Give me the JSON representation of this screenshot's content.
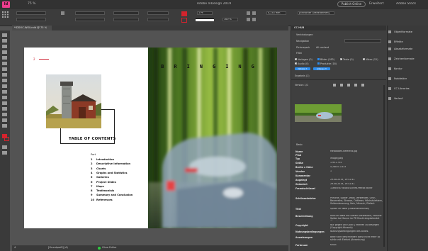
{
  "titlebar": {
    "app_badge": "Id",
    "zoom": "75 %",
    "title": "Adobe InDesign 2019",
    "workspace": "[Einfacher Grafikrahmen]",
    "publish_label": "Publish Online",
    "extended_label": "Erweitert",
    "search_placeholder": "Adobe Stock"
  },
  "control_bar": {
    "stroke_weight": "1 Pt",
    "opacity": "100 %",
    "width_value": "4,233 mm"
  },
  "document": {
    "tab_label": "*IDDOC-WOLindd @ 75 %",
    "page_number": "2",
    "toc_title": "TABLE OF CONTENTS",
    "part_label": "Part",
    "toc_items": [
      {
        "num": "1",
        "name": "Introduction"
      },
      {
        "num": "2",
        "name": "Descriptive Information"
      },
      {
        "num": "3",
        "name": "Charts"
      },
      {
        "num": "4",
        "name": "Graphs and Statistics"
      },
      {
        "num": "5",
        "name": "Galleries"
      },
      {
        "num": "6",
        "name": "Project Slides"
      },
      {
        "num": "7",
        "name": "Maps"
      },
      {
        "num": "8",
        "name": "Testimonials"
      },
      {
        "num": "9",
        "name": "Summary and Conclusion"
      },
      {
        "num": "10",
        "name": "References"
      }
    ],
    "spread_headline": "BRINGING"
  },
  "status_bar": {
    "page": "4",
    "profile": "[Grundprofil] (A)",
    "errors": "Ohne Fehler"
  },
  "cc_hub": {
    "title": "CC HUB",
    "connections": "Verbindungen",
    "navigation": "Navigation",
    "picture_mode": "Picturepark",
    "all_content": "All content",
    "filter": "Filter",
    "checkboxes_row1": [
      {
        "label": "Vorlagen (0)",
        "checked": false
      },
      {
        "label": "Bilder (183)",
        "checked": true
      },
      {
        "label": "Texte (0)",
        "checked": false
      },
      {
        "label": "Video (12)",
        "checked": false
      }
    ],
    "checkboxes_row2": [
      {
        "label": "Audio (0)",
        "checked": false
      },
      {
        "label": "Produkte (18)",
        "checked": true
      }
    ],
    "filter_tags": [
      "Natalie ✕",
      "Adresse ✕"
    ],
    "results_label": "Ergebnis (1)",
    "version_label": "Version 1/1",
    "section_basic": "Basic",
    "metadata": [
      {
        "key": "Name",
        "value": "Metadaten-Referenz.jpg"
      },
      {
        "key": "Pfad",
        "value": ""
      },
      {
        "key": "Typ",
        "value": "image/jpeg"
      },
      {
        "key": "Größe",
        "value": "1.951.754"
      },
      {
        "key": "Breite x Höhe",
        "value": "4.288 x 1.833"
      },
      {
        "key": "Version",
        "value": "1"
      },
      {
        "key": "Kommentar",
        "value": ""
      },
      {
        "key": "Angelegt",
        "value": "29.08.2019, 19:52:41"
      },
      {
        "key": "Geändert",
        "value": "29.08.2019, 19:52:41"
      },
      {
        "key": "Fremdschlüssel",
        "value": "11e85ca738484c18f3fb7e6f4b7b0b9"
      },
      {
        "key": "Schlüsselwörter",
        "value": "Porsche, Spider, Wald, Verwendet, Grün, Baumreihe, Strasse, Oldtimer, Höchstsiehlern, Seitensteuerung, Kein, Mensch, Elefant"
      },
      {
        "key": "Titel",
        "value": "Spider im Wald (Dokumentenintel)"
      },
      {
        "key": "Beschreibung",
        "value": "Auto im Wald mit Elefant verwackelt, Porsche Spider bei Sonne im PR Musik eingeblendet (Beschreibung)"
      },
      {
        "key": "Copyright",
        "value": "Nur gegen voll Gold & Mithren zu besorgen (Copyright-Hinweis)"
      },
      {
        "key": "Nutzungsbedingungen",
        "value": "Nutzungsbedingungen des Bildes."
      },
      {
        "key": "Anweisungen",
        "value": "Bitte nicht beschneiden sonst nicht mehr so schön mit Elefant (Anweisung)"
      },
      {
        "key": "Farbraum",
        "value": "sRGB"
      }
    ]
  },
  "dock": {
    "items": [
      "Objektformate",
      "Effekte",
      "Absatzformate",
      "Zeichenformate",
      "Kontur",
      "Farbfelder",
      "CC Libraries",
      "Verlauf"
    ]
  },
  "colors": {
    "accent": "#2d8ceb",
    "page_red": "#d02a3a",
    "app_badge": "#ee3d8f"
  }
}
